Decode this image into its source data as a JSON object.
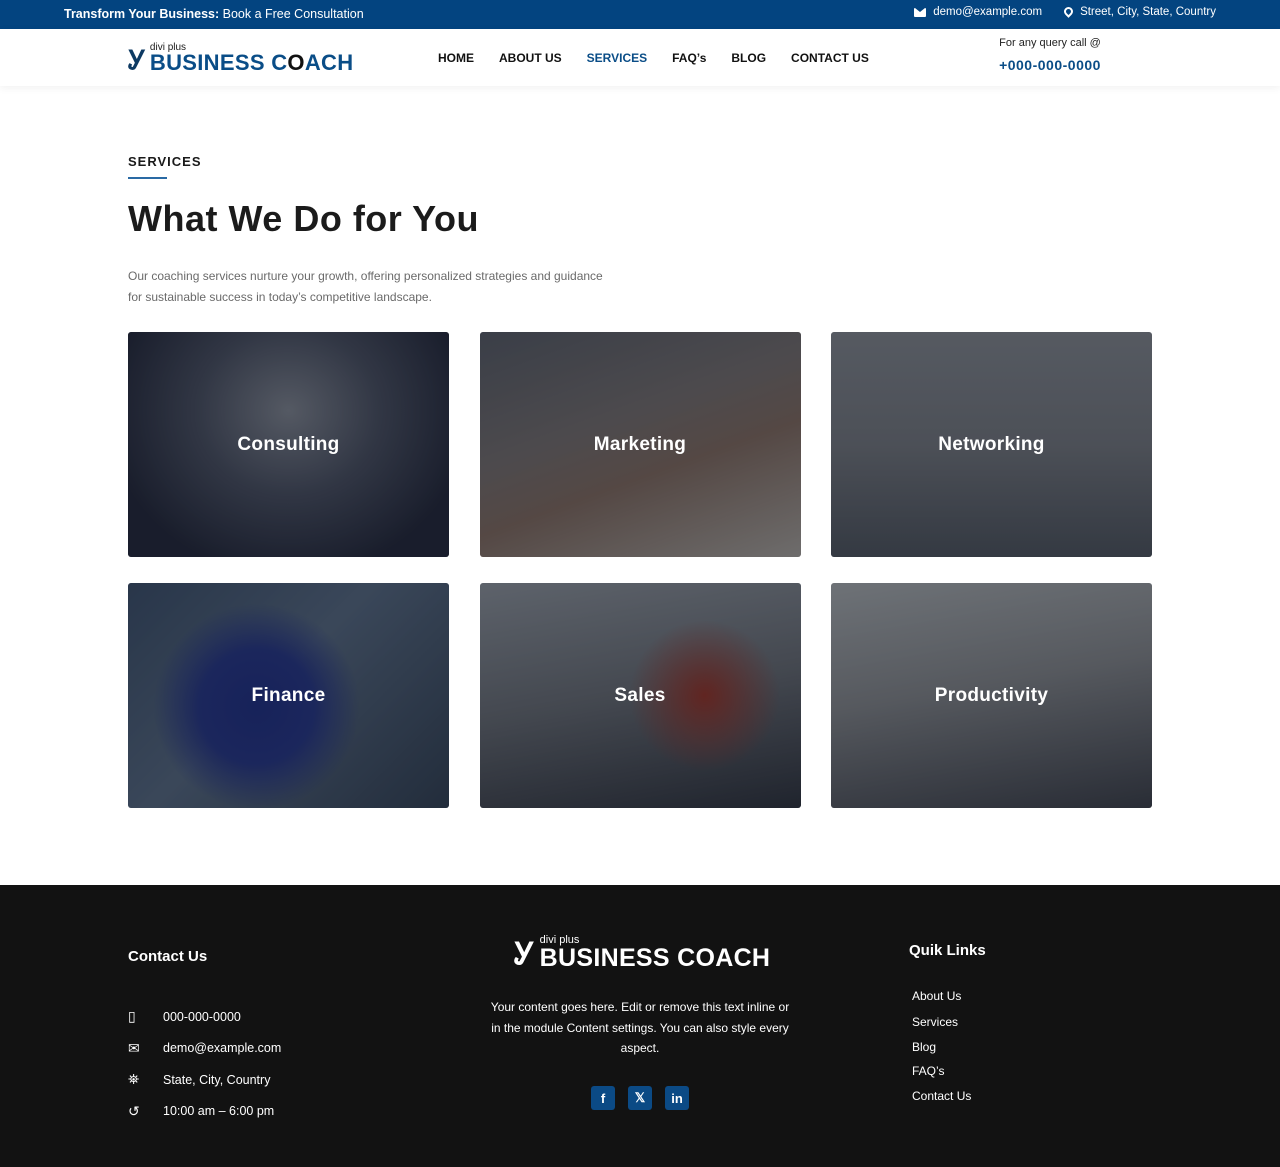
{
  "topbar": {
    "promo_bold": "Transform Your Business:",
    "promo_text": " Book a Free Consultation",
    "email": "demo@example.com",
    "address": "Street, City, State, Country"
  },
  "header": {
    "logo_mark": "Ꭹ",
    "logo_small": "divi plus",
    "logo_big_1": "BUSINESS C",
    "logo_big_o": "O",
    "logo_big_2": "ACH",
    "nav": [
      {
        "label": "HOME",
        "active": false
      },
      {
        "label": "ABOUT US",
        "active": false
      },
      {
        "label": "SERVICES",
        "active": true
      },
      {
        "label": "FAQ’s",
        "active": false
      },
      {
        "label": "BLOG",
        "active": false
      },
      {
        "label": "CONTACT US",
        "active": false
      }
    ],
    "call_label": "For any query call @",
    "call_phone": "+000-000-0000"
  },
  "section": {
    "eyebrow": "SERVICES",
    "title": "What We Do for You",
    "description": "Our coaching services nurture your growth, offering personalized strategies and guidance for sustainable success in today’s competitive landscape."
  },
  "services": [
    {
      "label": "Consulting"
    },
    {
      "label": "Marketing"
    },
    {
      "label": "Networking"
    },
    {
      "label": "Finance"
    },
    {
      "label": "Sales"
    },
    {
      "label": "Productivity"
    }
  ],
  "footer": {
    "contact_heading": "Contact Us",
    "contact": [
      {
        "icon": "phone-icon",
        "glyph": "▯",
        "text": "000-000-0000"
      },
      {
        "icon": "mail-icon",
        "glyph": "✉",
        "text": "demo@example.com"
      },
      {
        "icon": "map-icon",
        "glyph": "⛯",
        "text": "State, City, Country"
      },
      {
        "icon": "history-icon",
        "glyph": "↺",
        "text": "10:00 am – 6:00 pm"
      }
    ],
    "logo_mark": "Ꭹ",
    "logo_small": "divi plus",
    "logo_big": "BUSINESS COACH",
    "text": "Your content goes here. Edit or remove this text inline or in the module Content settings. You can also style every aspect.",
    "socials": [
      {
        "name": "facebook-icon",
        "glyph": "f"
      },
      {
        "name": "x-icon",
        "glyph": "𝕏"
      },
      {
        "name": "linkedin-icon",
        "glyph": "in"
      }
    ],
    "links_heading": "Quik Links",
    "links": [
      "About Us",
      "Services",
      "Blog",
      "FAQ’s",
      "Contact Us"
    ]
  }
}
